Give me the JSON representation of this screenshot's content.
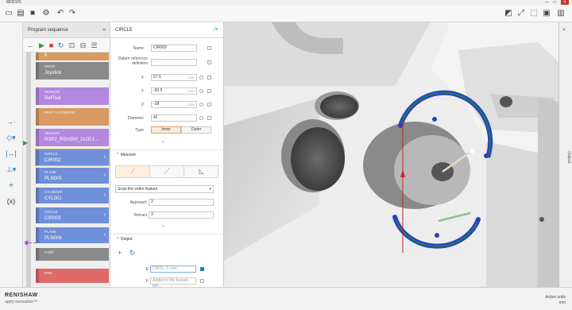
{
  "app": {
    "title": "MODUS"
  },
  "window": {
    "min": "—",
    "max": "□",
    "close": "✕"
  },
  "sequence": {
    "title": "Program sequence",
    "blocks": [
      {
        "type": "",
        "name": "0",
        "color": "#d99a63"
      },
      {
        "type": "MODE",
        "name": "Joystick",
        "color": "#8a8a8a"
      },
      {
        "type": "SENSOR",
        "name": "RefTool",
        "color": "#b388e0"
      },
      {
        "type": "PART ALIGNMENT",
        "name": "",
        "color": "#d99a63"
      },
      {
        "type": "SENSOR",
        "name": "RSP2_RSH350_2x20,1...",
        "color": "#b388e0"
      },
      {
        "type": "CIRCLE",
        "name": "CIR002",
        "color": "#6f8fd8",
        "selected": true
      },
      {
        "type": "PLANE",
        "name": "PLN005",
        "color": "#6f8fd8"
      },
      {
        "type": "CYLINDER",
        "name": "CYL001",
        "color": "#6f8fd8"
      },
      {
        "type": "CIRCLE",
        "name": "CIR003",
        "color": "#6f8fd8"
      },
      {
        "type": "PLANE",
        "name": "PLN006",
        "color": "#6f8fd8"
      },
      {
        "type": "STOP",
        "name": "",
        "color": "#8a8a8a"
      },
      {
        "type": "END",
        "name": "",
        "color": "#e06a6a"
      }
    ]
  },
  "props": {
    "title": "CIRCLE",
    "name_label": "Name",
    "name_value": "CIR002",
    "datum_label": "Datum reference definition",
    "x_label": "X",
    "x_value": "27.5",
    "y_label": "Y",
    "y_value": "-92.5",
    "z_label": "Z",
    "z_value": "-38",
    "unit": "CAD",
    "diameter_label": "Diameter",
    "diameter_value": "42",
    "type_label": "Type",
    "type_inner": "Inner",
    "type_outer": "Outer",
    "measure_title": "Measure",
    "scan_option": "Scan the entire feature",
    "approach_label": "Approach",
    "approach_value": "3",
    "retract_label": "Retract",
    "retract_value": "3",
    "output_title": "Output",
    "e_label": "E",
    "e_placeholder": "CIR01_2.com",
    "f_label": "F",
    "f_placeholder": "Added to the feature set..."
  },
  "right": {
    "output_label": "Output"
  },
  "status": {
    "brand": "RENISHAW",
    "tagline": "apply innovation™",
    "active_label": "Active units",
    "active_value": "mm"
  }
}
